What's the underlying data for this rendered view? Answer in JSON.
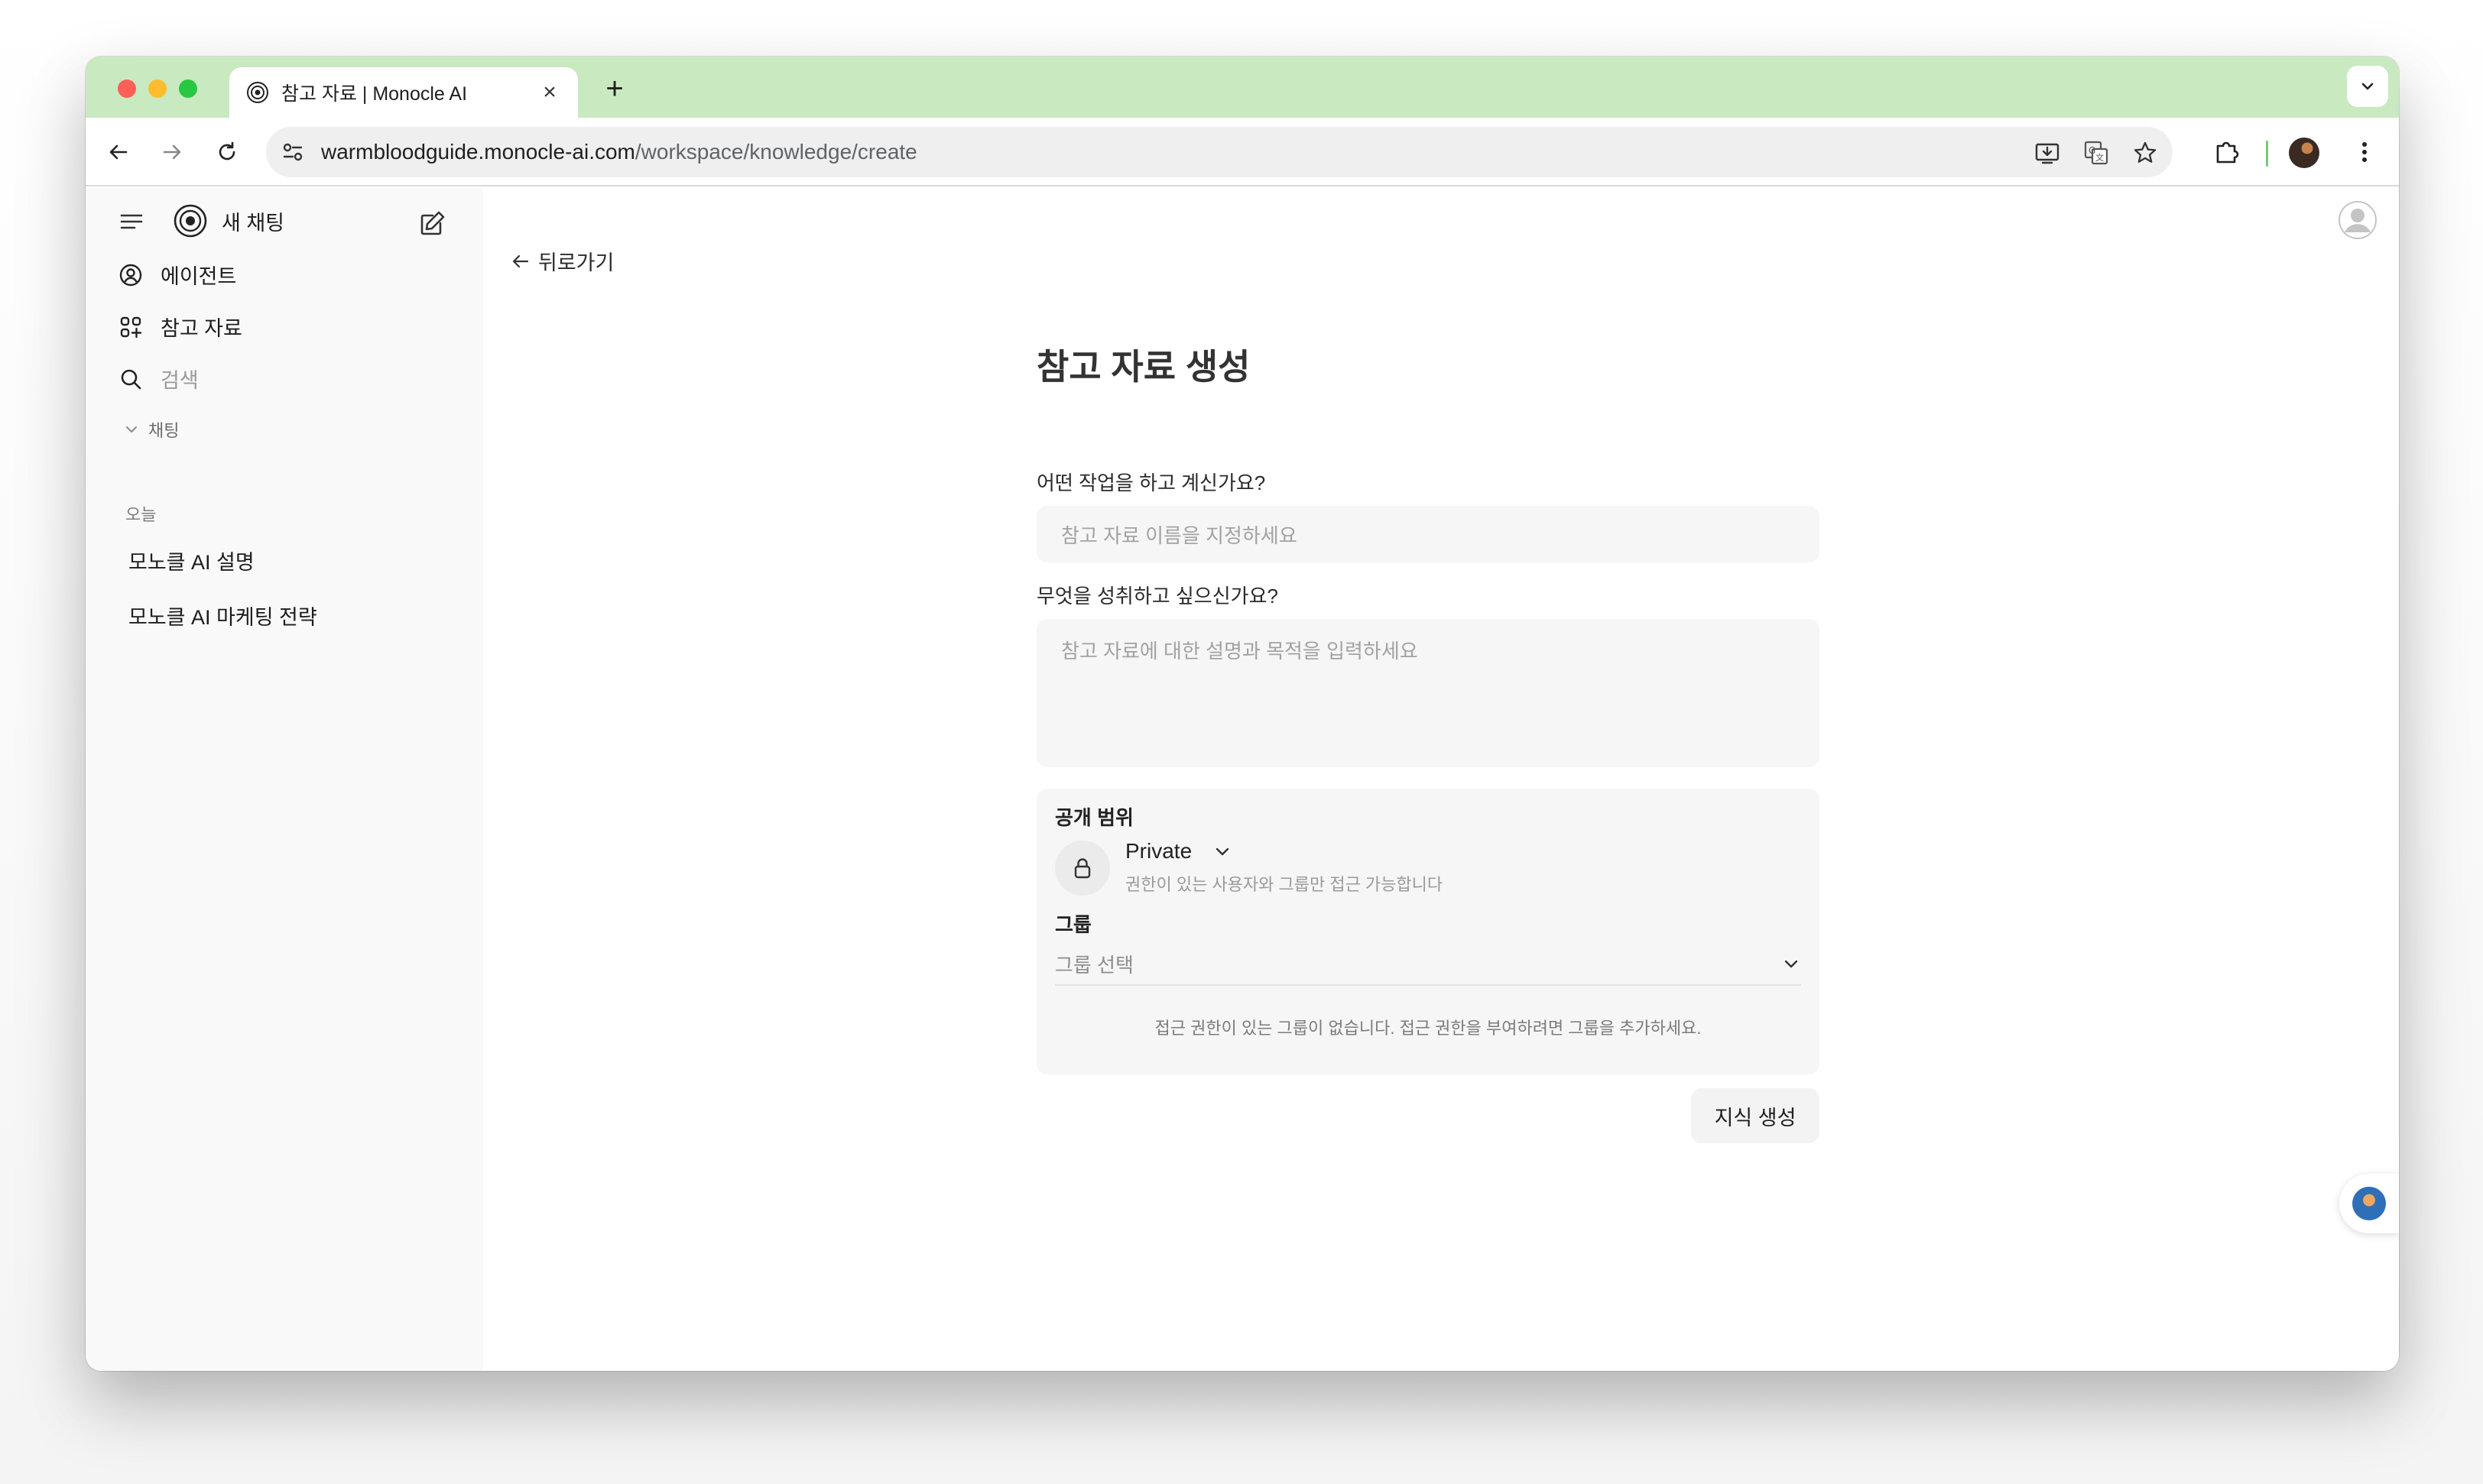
{
  "browser": {
    "tab_title": "참고 자료 | Monocle AI",
    "tab_close": "×",
    "new_tab": "+",
    "url_host": "warmbloodguide.monocle-ai.com",
    "url_path": "/workspace/knowledge/create"
  },
  "sidebar": {
    "new_chat": "새 채팅",
    "items": [
      {
        "label": "에이전트",
        "icon": "user-circle-icon"
      },
      {
        "label": "참고 자료",
        "icon": "grid-plus-icon"
      }
    ],
    "search_placeholder": "검색",
    "section_label": "채팅",
    "day_label": "오늘",
    "chats": [
      "모노클 AI 설명",
      "모노클 AI 마케팅 전략"
    ]
  },
  "main": {
    "back_label": "뒤로가기",
    "title": "참고 자료 생성",
    "name_question": "어떤 작업을 하고 계신가요?",
    "name_placeholder": "참고 자료 이름을 지정하세요",
    "goal_question": "무엇을 성취하고 싶으신가요?",
    "goal_placeholder": "참고 자료에 대한 설명과 목적을 입력하세요",
    "visibility": {
      "label": "공개 범위",
      "value": "Private",
      "description": "권한이 있는 사용자와 그룹만 접근 가능합니다"
    },
    "group": {
      "label": "그룹",
      "placeholder": "그룹 선택",
      "note": "접근 권한이 있는 그룹이 없습니다. 접근 권한을 부여하려면 그룹을 추가하세요."
    },
    "submit_label": "지식 생성"
  },
  "colors": {
    "tab_strip": "#c9e9c0",
    "sidebar_bg": "#f9f9f9",
    "input_bg": "#f6f6f6"
  }
}
